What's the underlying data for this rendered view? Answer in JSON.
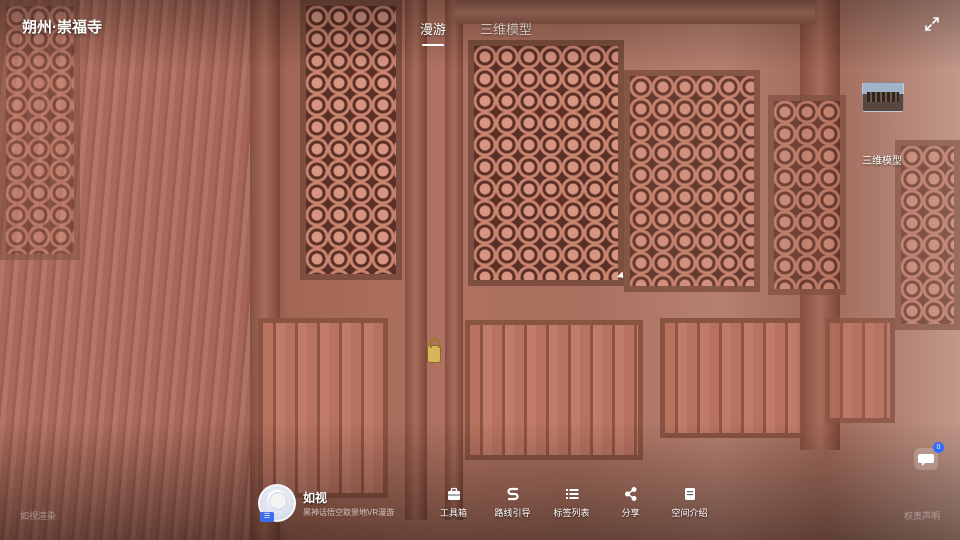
{
  "header": {
    "title": "朔州·崇福寺",
    "tabs": [
      {
        "label": "漫游",
        "active": true
      },
      {
        "label": "三维模型",
        "active": false
      }
    ],
    "fullscreen_icon": "expand-icon"
  },
  "thumbnail": {
    "label": "三维模型"
  },
  "anchor": {
    "name": "如视",
    "description": "黑神话悟空取景地VR漫游",
    "badge": "☰"
  },
  "toolbar": {
    "items": [
      {
        "label": "工具箱",
        "icon": "toolbox-icon"
      },
      {
        "label": "路线引导",
        "icon": "route-icon"
      },
      {
        "label": "标签列表",
        "icon": "list-icon"
      },
      {
        "label": "分享",
        "icon": "share-icon"
      },
      {
        "label": "空间介绍",
        "icon": "document-icon"
      }
    ]
  },
  "footer": {
    "left_text": "如视渲染",
    "right_text": "权责声明"
  },
  "chat": {
    "count": "0"
  }
}
